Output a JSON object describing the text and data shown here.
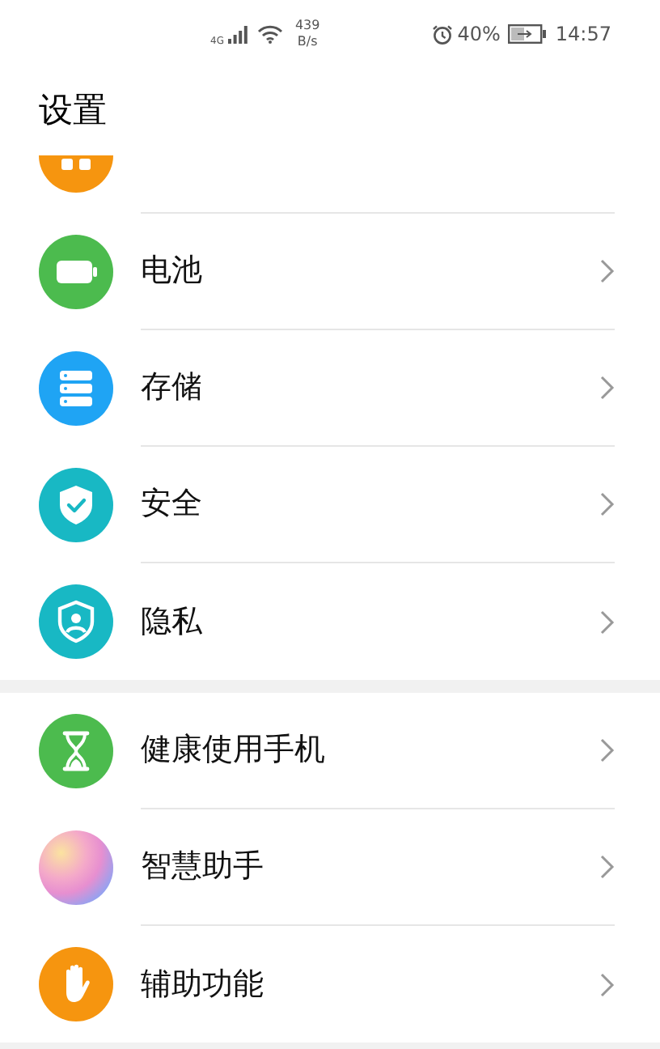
{
  "status_bar": {
    "network": "4G",
    "speed_value": "439",
    "speed_unit": "B/s",
    "battery_percent": "40%",
    "time": "14:57"
  },
  "title": "设置",
  "partial_item": {
    "kind": "apps",
    "color": "#f6950f"
  },
  "sections": [
    {
      "items": [
        {
          "label": "电池",
          "kind": "battery",
          "color": "#4cbb4e"
        },
        {
          "label": "存储",
          "kind": "storage",
          "color": "#1fa4f4"
        },
        {
          "label": "安全",
          "kind": "shield",
          "color": "#18b8c4"
        },
        {
          "label": "隐私",
          "kind": "privacy",
          "color": "#18b8c4"
        }
      ]
    },
    {
      "items": [
        {
          "label": "健康使用手机",
          "kind": "hourglass",
          "color": "#4cbb4e"
        },
        {
          "label": "智慧助手",
          "kind": "assistant",
          "color": "#e78fd0"
        },
        {
          "label": "辅助功能",
          "kind": "hand",
          "color": "#f6950f"
        }
      ]
    }
  ]
}
